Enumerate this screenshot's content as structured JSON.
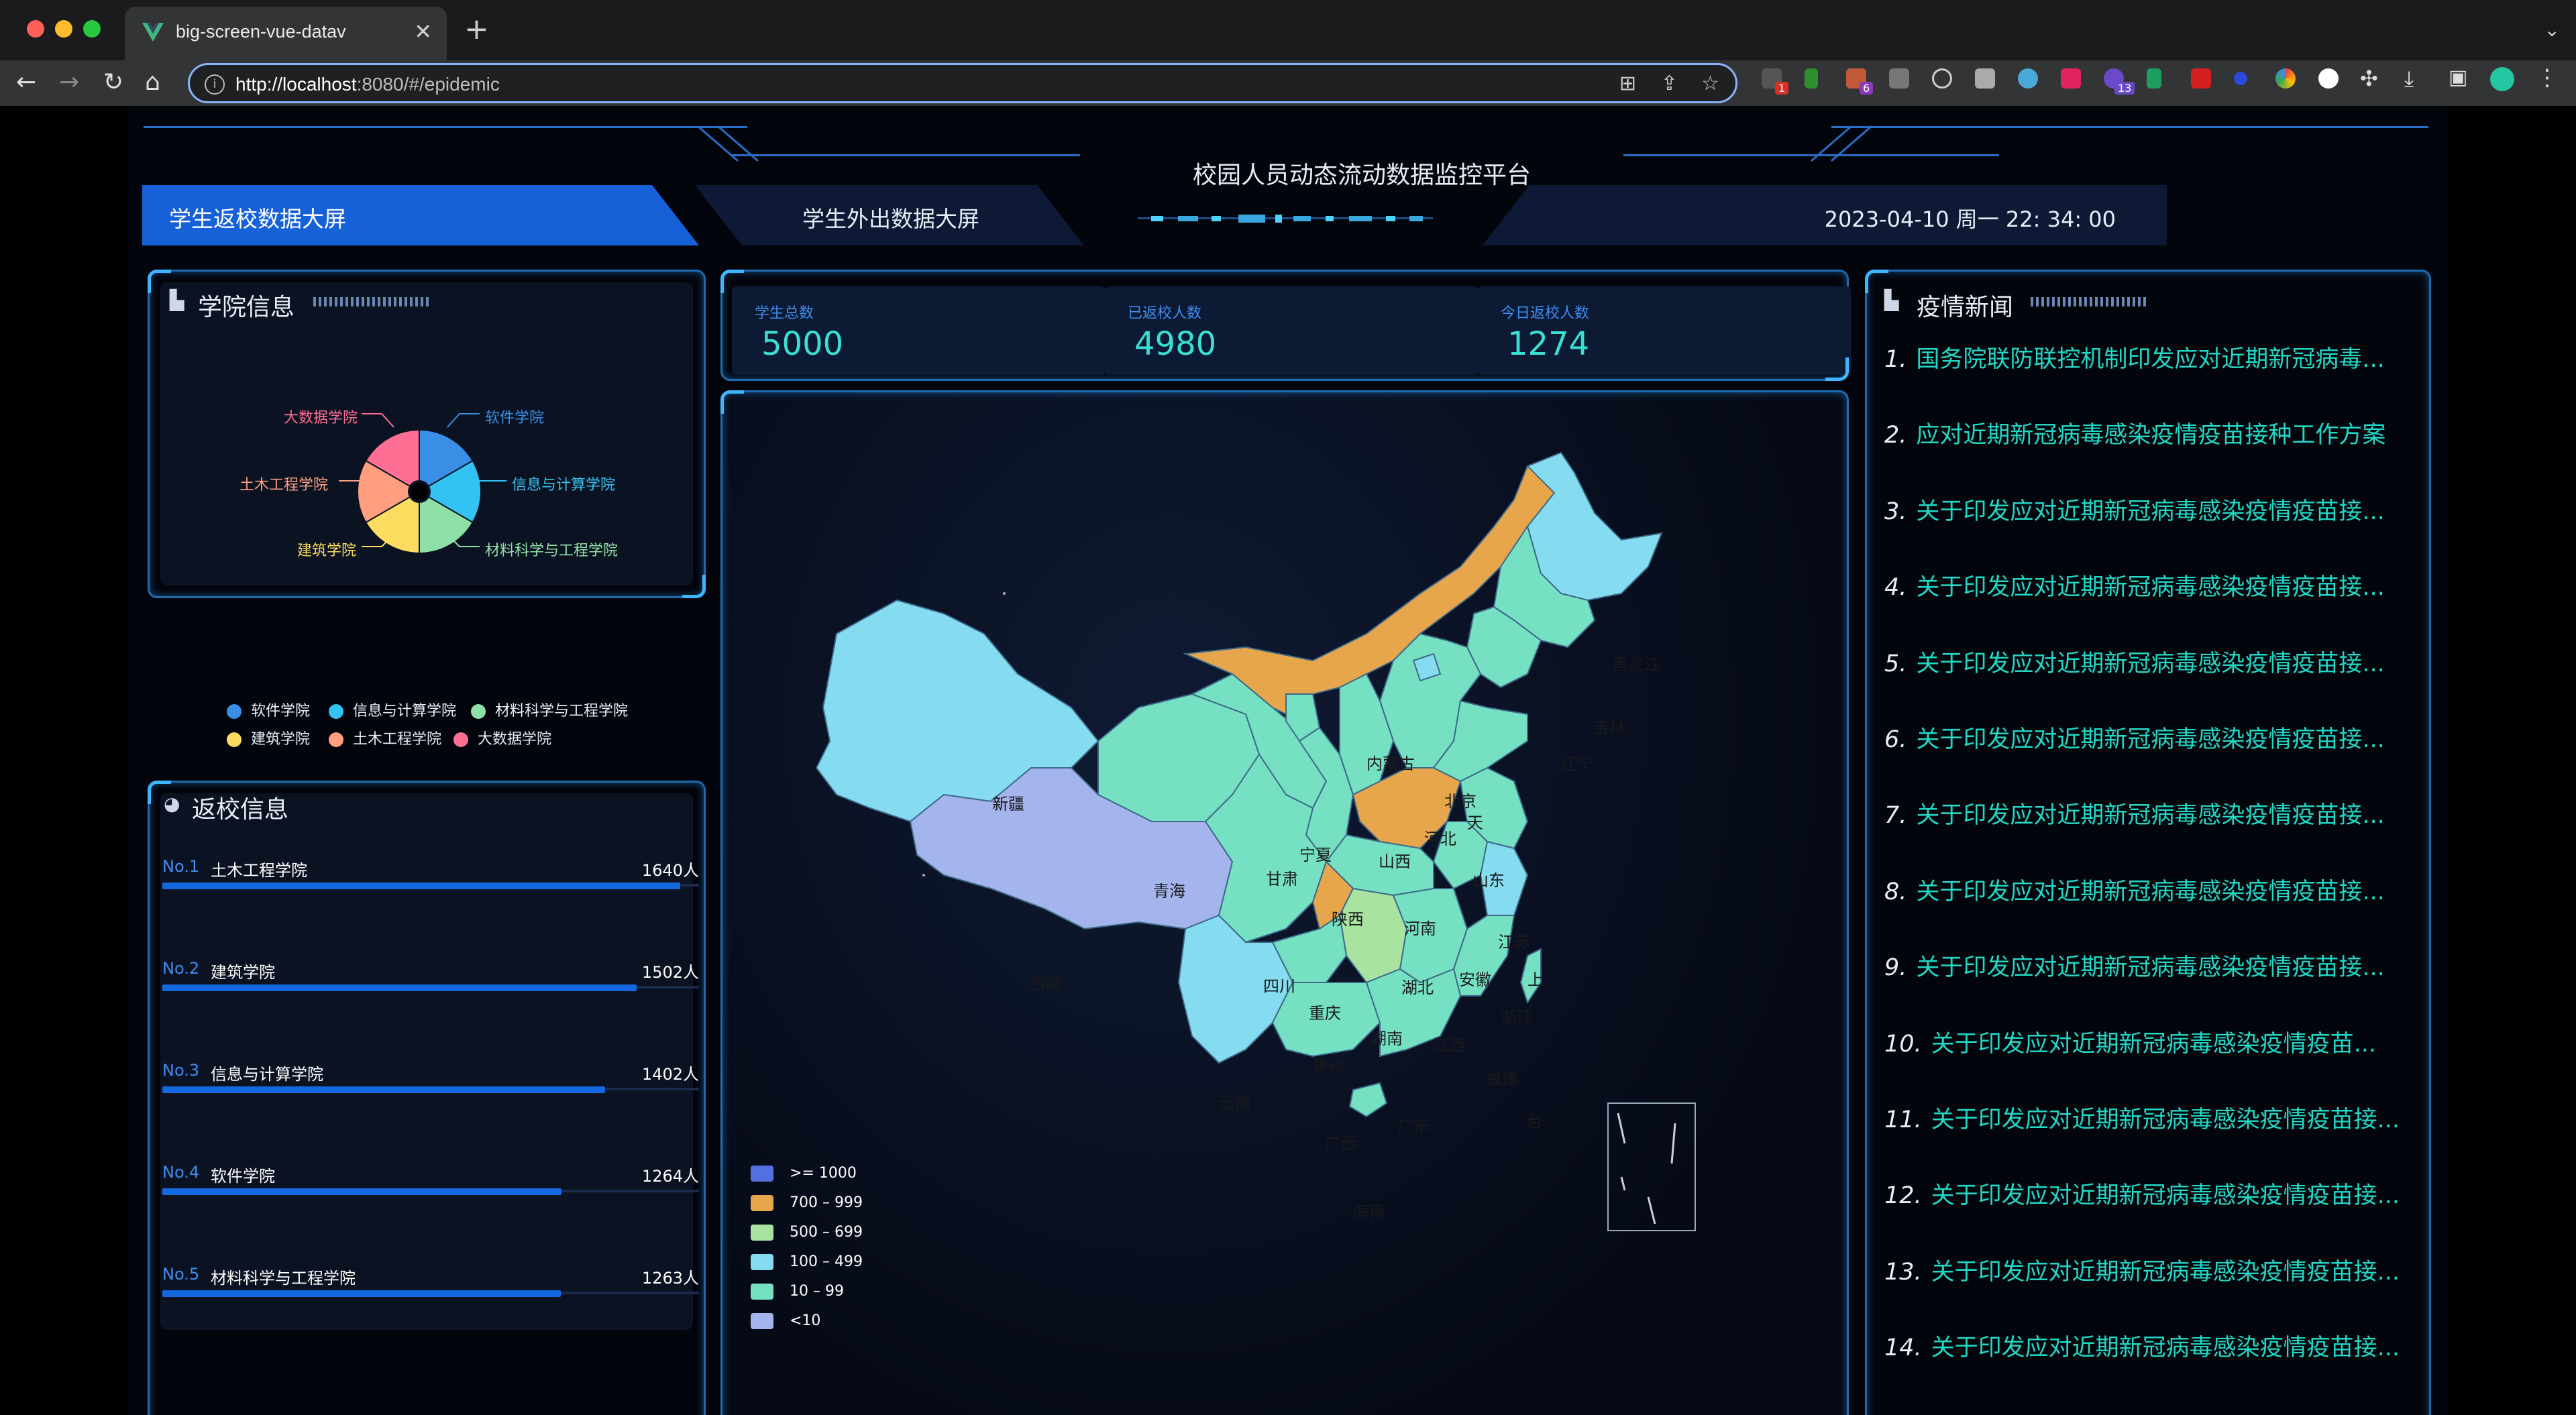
{
  "browser": {
    "tab_title": "big-screen-vue-datav",
    "url_host": "http://localhost",
    "url_rest": ":8080/#/epidemic",
    "badges": {
      "ext1": "1",
      "ext2": "6",
      "ext3": "13"
    }
  },
  "header": {
    "title": "校园人员动态流动数据监控平台",
    "tab_active": "学生返校数据大屏",
    "tab_inactive": "学生外出数据大屏",
    "datetime": "2023-04-10 周一 22: 34: 00"
  },
  "college": {
    "title": "学院信息",
    "items": [
      {
        "name": "软件学院",
        "color": "#3a8ee6",
        "value": 1
      },
      {
        "name": "信息与计算学院",
        "color": "#33c3f2",
        "value": 1
      },
      {
        "name": "材料科学与工程学院",
        "color": "#8fe0a8",
        "value": 1
      },
      {
        "name": "建筑学院",
        "color": "#fddd60",
        "value": 1
      },
      {
        "name": "土木工程学院",
        "color": "#ff9f7f",
        "value": 1
      },
      {
        "name": "大数据学院",
        "color": "#ff6e93",
        "value": 1
      }
    ]
  },
  "return": {
    "title": "返校信息",
    "max": 1700,
    "rows": [
      {
        "no": "No.1",
        "name": "土木工程学院",
        "value": 1640,
        "label": "1640人"
      },
      {
        "no": "No.2",
        "name": "建筑学院",
        "value": 1502,
        "label": "1502人"
      },
      {
        "no": "No.3",
        "name": "信息与计算学院",
        "value": 1402,
        "label": "1402人"
      },
      {
        "no": "No.4",
        "name": "软件学院",
        "value": 1264,
        "label": "1264人"
      },
      {
        "no": "No.5",
        "name": "材料科学与工程学院",
        "value": 1263,
        "label": "1263人"
      }
    ]
  },
  "stats": [
    {
      "label": "学生总数",
      "value": "5000"
    },
    {
      "label": "已返校人数",
      "value": "4980"
    },
    {
      "label": "今日返校人数",
      "value": "1274"
    }
  ],
  "map": {
    "legend": [
      {
        "label": ">= 1000",
        "color": "#5470e0"
      },
      {
        "label": "700 – 999",
        "color": "#e8a64c"
      },
      {
        "label": "500 – 699",
        "color": "#a8e4a0"
      },
      {
        "label": "100 – 499",
        "color": "#85dcf0"
      },
      {
        "label": "10 – 99",
        "color": "#76e0c2"
      },
      {
        "label": "<10",
        "color": "#a4b4ec"
      }
    ],
    "provinces": [
      "黑龙江",
      "吉林",
      "辽宁",
      "内蒙古",
      "北京",
      "天",
      "河北",
      "山西",
      "宁夏",
      "甘肃",
      "青海",
      "新疆",
      "西藏",
      "陕西",
      "河南",
      "山东",
      "江苏",
      "安徽",
      "上",
      "湖北",
      "四川",
      "重庆",
      "浙江",
      "湖南",
      "江西",
      "贵州",
      "云南",
      "福建",
      "广西",
      "广东",
      "台",
      "海南"
    ]
  },
  "news": {
    "title": "疫情新闻",
    "items": [
      {
        "num": "1.",
        "text": "国务院联防联控机制印发应对近期新冠病毒..."
      },
      {
        "num": "2.",
        "text": "应对近期新冠病毒感染疫情疫苗接种工作方案"
      },
      {
        "num": "3.",
        "text": "关于印发应对近期新冠病毒感染疫情疫苗接..."
      },
      {
        "num": "4.",
        "text": "关于印发应对近期新冠病毒感染疫情疫苗接..."
      },
      {
        "num": "5.",
        "text": "关于印发应对近期新冠病毒感染疫情疫苗接..."
      },
      {
        "num": "6.",
        "text": "关于印发应对近期新冠病毒感染疫情疫苗接..."
      },
      {
        "num": "7.",
        "text": "关于印发应对近期新冠病毒感染疫情疫苗接..."
      },
      {
        "num": "8.",
        "text": "关于印发应对近期新冠病毒感染疫情疫苗接..."
      },
      {
        "num": "9.",
        "text": "关于印发应对近期新冠病毒感染疫情疫苗接..."
      },
      {
        "num": "10.",
        "text": "关于印发应对近期新冠病毒感染疫情疫苗..."
      },
      {
        "num": "11.",
        "text": "关于印发应对近期新冠病毒感染疫情疫苗接..."
      },
      {
        "num": "12.",
        "text": "关于印发应对近期新冠病毒感染疫情疫苗接..."
      },
      {
        "num": "13.",
        "text": "关于印发应对近期新冠病毒感染疫情疫苗接..."
      },
      {
        "num": "14.",
        "text": "关于印发应对近期新冠病毒感染疫情疫苗接..."
      }
    ]
  }
}
